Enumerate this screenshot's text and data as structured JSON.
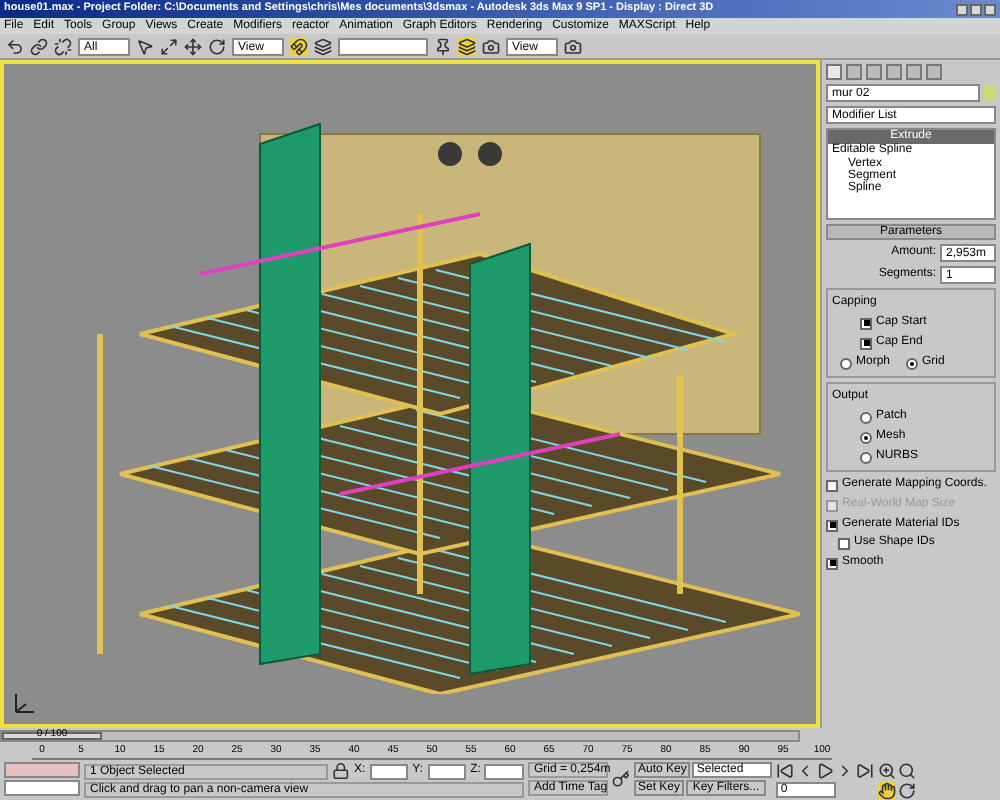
{
  "window": {
    "title": "house01.max - Project Folder: C:\\Documents and Settings\\chris\\Mes documents\\3dsmax - Autodesk 3ds Max 9 SP1 - Display : Direct 3D"
  },
  "menu": [
    "File",
    "Edit",
    "Tools",
    "Group",
    "Views",
    "Create",
    "Modifiers",
    "reactor",
    "Animation",
    "Graph Editors",
    "Rendering",
    "Customize",
    "MAXScript",
    "Help"
  ],
  "toolbar": {
    "selection_filter": "All",
    "reference_coord": "View",
    "render_view": "View"
  },
  "command_panel": {
    "object_name": "mur 02",
    "modifier_list": "Modifier List",
    "stack": [
      {
        "label": "Extrude",
        "selected": true
      },
      {
        "label": "Editable Spline",
        "selected": false,
        "children": [
          {
            "label": "Vertex",
            "selected": false
          },
          {
            "label": "Segment",
            "selected": false
          },
          {
            "label": "Spline",
            "selected": false
          }
        ]
      }
    ],
    "rollout": "Parameters",
    "amount": {
      "label": "Amount:",
      "value": "2,953m"
    },
    "segments": {
      "label": "Segments:",
      "value": "1"
    },
    "capping": {
      "title": "Capping",
      "checks": [
        {
          "label": "Cap Start",
          "checked": true
        },
        {
          "label": "Cap End",
          "checked": true
        }
      ],
      "radios": [
        {
          "label": "Morph",
          "selected": false
        },
        {
          "label": "Grid",
          "selected": true
        }
      ]
    },
    "output": {
      "title": "Output",
      "radios": [
        {
          "label": "Patch",
          "selected": false
        },
        {
          "label": "Mesh",
          "selected": true
        },
        {
          "label": "NURBS",
          "selected": false
        }
      ]
    },
    "options": [
      {
        "label": "Generate Mapping Coords.",
        "checked": false,
        "disabled": false
      },
      {
        "label": "Real-World Map Size",
        "checked": false,
        "disabled": true
      },
      {
        "label": "Generate Material IDs",
        "checked": true,
        "disabled": false,
        "children": [
          {
            "label": "Use Shape IDs",
            "checked": false,
            "disabled": false
          }
        ]
      },
      {
        "label": "Smooth",
        "checked": true,
        "disabled": false
      }
    ]
  },
  "time_slider": {
    "label": "0 / 100",
    "level": 0
  },
  "ruler": [
    "0",
    "5",
    "10",
    "15",
    "20",
    "25",
    "30",
    "35",
    "40",
    "45",
    "50",
    "55",
    "60",
    "65",
    "70",
    "75",
    "80",
    "85",
    "90",
    "95",
    "100"
  ],
  "status": {
    "selection": "1 Object Selected",
    "prompt": "Click and drag to pan a non-camera view",
    "x_label": "X:",
    "y_label": "Y:",
    "z_label": "Z:",
    "grid": "Grid = 0,254m",
    "add_time_tag": "Add Time Tag",
    "auto_key": "Auto Key",
    "set_key": "Set Key",
    "key_mode": "Selected",
    "key_filters": "Key Filters...",
    "frame": "0"
  }
}
